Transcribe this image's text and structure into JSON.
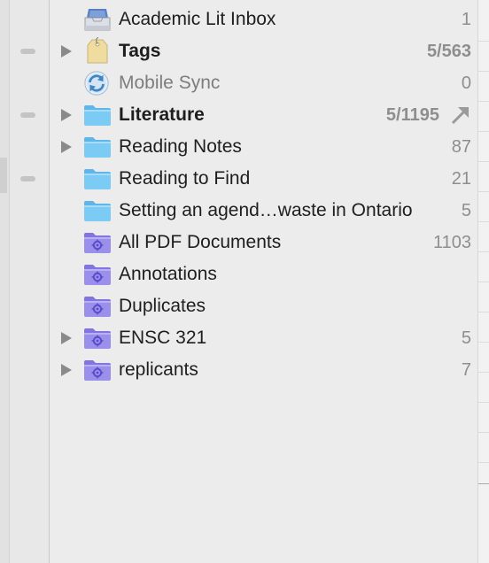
{
  "collections": [
    {
      "label": "Academic Lit Inbox",
      "count": "1",
      "icon": "inbox-tray-icon",
      "disclosure": false,
      "bold": false,
      "muted": false,
      "gutter_dash": false
    },
    {
      "label": "Tags",
      "count": "5/563",
      "icon": "tag-icon",
      "disclosure": true,
      "bold": true,
      "muted": false,
      "gutter_dash": true
    },
    {
      "label": "Mobile Sync",
      "count": "0",
      "icon": "sync-icon",
      "disclosure": false,
      "bold": false,
      "muted": true,
      "gutter_dash": false
    },
    {
      "label": "Literature",
      "count": "5/1195",
      "icon": "folder-icon",
      "disclosure": true,
      "bold": true,
      "muted": false,
      "gutter_dash": true,
      "shared_arrow": true
    },
    {
      "label": "Reading Notes",
      "count": "87",
      "icon": "folder-icon",
      "disclosure": true,
      "bold": false,
      "muted": false,
      "gutter_dash": false
    },
    {
      "label": "Reading to Find",
      "count": "21",
      "icon": "folder-icon",
      "disclosure": false,
      "bold": false,
      "muted": false,
      "gutter_dash": true
    },
    {
      "label": "Setting an agend…waste in Ontario",
      "count": "5",
      "icon": "folder-icon",
      "disclosure": false,
      "bold": false,
      "muted": false,
      "gutter_dash": false
    },
    {
      "label": "All PDF Documents",
      "count": "1103",
      "icon": "smart-folder-icon",
      "disclosure": false,
      "bold": false,
      "muted": false,
      "gutter_dash": false
    },
    {
      "label": "Annotations",
      "count": "",
      "icon": "smart-folder-icon",
      "disclosure": false,
      "bold": false,
      "muted": false,
      "gutter_dash": false
    },
    {
      "label": "Duplicates",
      "count": "",
      "icon": "smart-folder-icon",
      "disclosure": false,
      "bold": false,
      "muted": false,
      "gutter_dash": false
    },
    {
      "label": "ENSC 321",
      "count": "5",
      "icon": "smart-folder-icon",
      "disclosure": true,
      "bold": false,
      "muted": false,
      "gutter_dash": false
    },
    {
      "label": "replicants",
      "count": "7",
      "icon": "smart-folder-icon",
      "disclosure": true,
      "bold": false,
      "muted": false,
      "gutter_dash": false
    }
  ],
  "colors": {
    "folder_blue": "#7ccbf5",
    "smart_folder_purple": "#9b8fec",
    "tag_yellow": "#efdc9e",
    "sync_blue": "#3d86c6",
    "count_gray": "#8e8e8e"
  }
}
